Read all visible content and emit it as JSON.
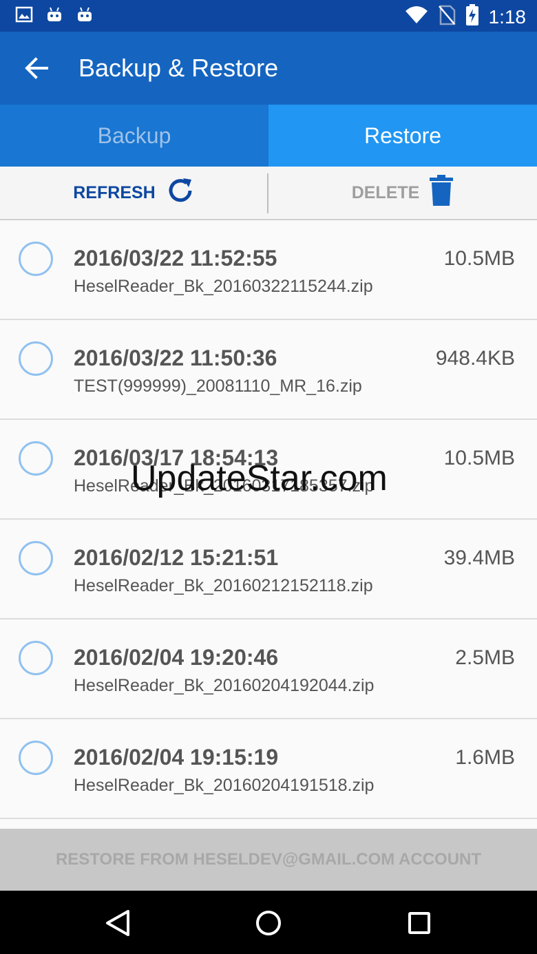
{
  "status_bar": {
    "time": "1:18",
    "left_icons": [
      "image-icon",
      "android-icon",
      "android-icon"
    ],
    "right_icons": [
      "wifi-icon",
      "no-sim-icon",
      "battery-charging-icon"
    ]
  },
  "app_bar": {
    "title": "Backup & Restore",
    "back_icon": "back-arrow-icon"
  },
  "tabs": [
    {
      "label": "Backup",
      "active": false
    },
    {
      "label": "Restore",
      "active": true
    }
  ],
  "actions": {
    "refresh_label": "REFRESH",
    "delete_label": "DELETE"
  },
  "backups": [
    {
      "date": "2016/03/22 11:52:55",
      "file": "HeselReader_Bk_20160322115244.zip",
      "size": "10.5MB"
    },
    {
      "date": "2016/03/22 11:50:36",
      "file": "TEST(999999)_20081110_MR_16.zip",
      "size": "948.4KB"
    },
    {
      "date": "2016/03/17 18:54:13",
      "file": "HeselReader_Bk_20160317185357.zip",
      "size": "10.5MB"
    },
    {
      "date": "2016/02/12 15:21:51",
      "file": "HeselReader_Bk_20160212152118.zip",
      "size": "39.4MB"
    },
    {
      "date": "2016/02/04 19:20:46",
      "file": "HeselReader_Bk_20160204192044.zip",
      "size": "2.5MB"
    },
    {
      "date": "2016/02/04 19:15:19",
      "file": "HeselReader_Bk_20160204191518.zip",
      "size": "1.6MB"
    }
  ],
  "restore_account_label": "RESTORE FROM HESELDEV@GMAIL.COM ACCOUNT",
  "watermark": "UpdateStar.com",
  "colors": {
    "status_bar": "#0d47a1",
    "app_bar": "#1565c0",
    "tab_inactive": "#1976d2",
    "tab_active": "#2196f3",
    "refresh": "#0d47a1",
    "delete": "#1565c0"
  }
}
